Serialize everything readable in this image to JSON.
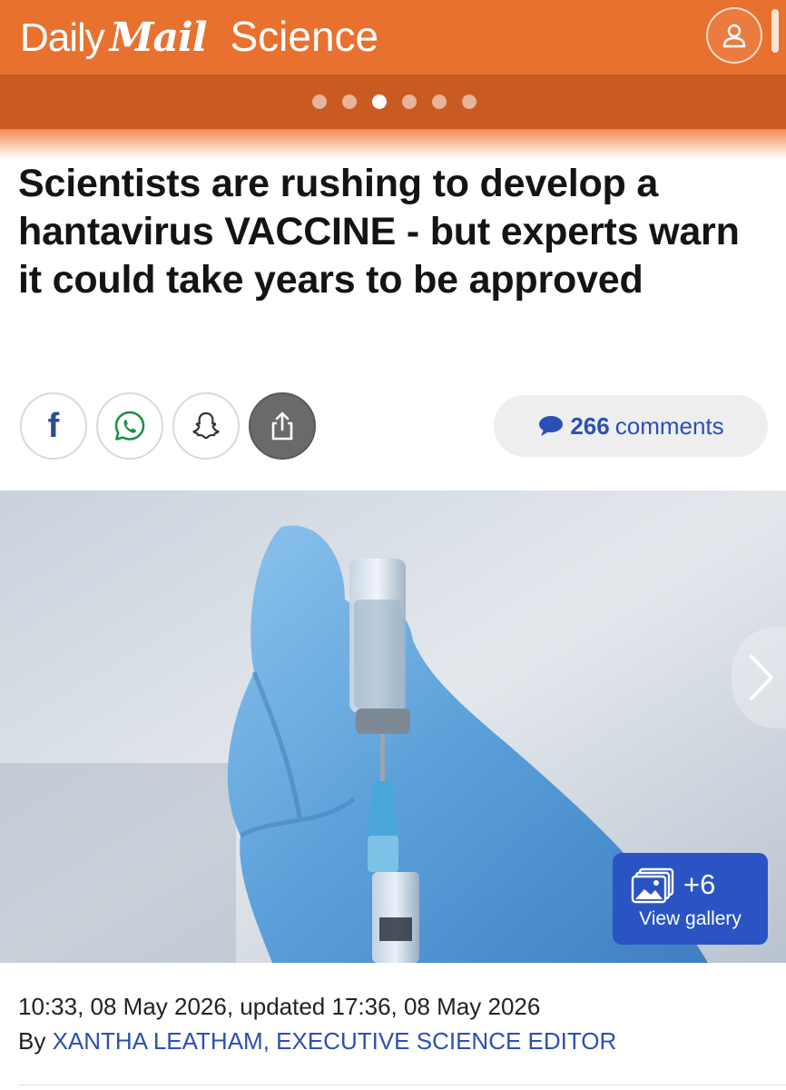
{
  "header": {
    "brand_daily": "Daily",
    "brand_mail": "Mail",
    "section": "Science",
    "account_icon": "person-icon"
  },
  "carousel": {
    "dot_count": 6,
    "active_dot": 3
  },
  "article": {
    "headline": "Scientists are rushing to develop a hantavirus VACCINE - but experts warn it could take years to be approved",
    "comments_count": "266",
    "comments_label": "comments",
    "timestamp": "10:33, 08 May 2026, updated 17:36, 08 May 2026",
    "byline_prefix": "By",
    "author": "XANTHA LEATHAM, EXECUTIVE SCIENCE EDITOR"
  },
  "share": {
    "facebook": "facebook-icon",
    "whatsapp": "whatsapp-icon",
    "snapchat": "snapchat-icon",
    "share": "share-icon"
  },
  "gallery": {
    "count": "+6",
    "label": "View gallery"
  },
  "colors": {
    "header_orange": "#e8712f",
    "dotbar_orange": "#c95a22",
    "link_blue": "#2b4fb4",
    "gallery_blue": "#2a54c3"
  }
}
